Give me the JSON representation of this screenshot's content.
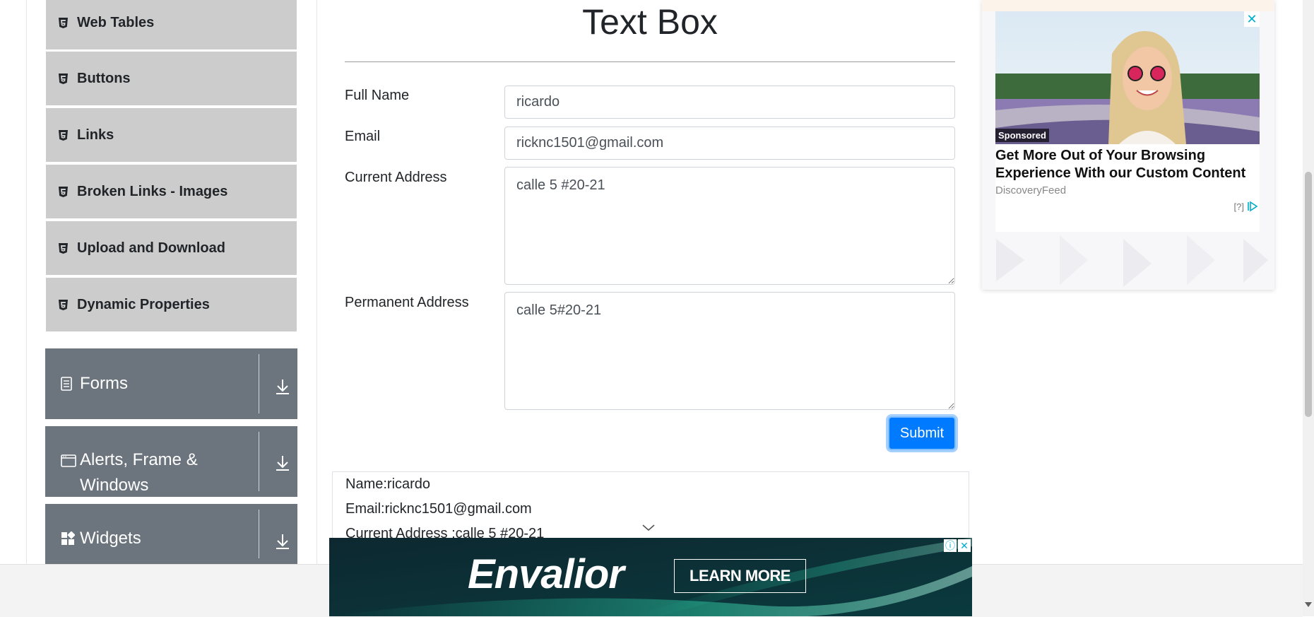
{
  "sidebar": {
    "elements_items": [
      {
        "label": "Web Tables",
        "icon": "html5-icon"
      },
      {
        "label": "Buttons",
        "icon": "html5-icon"
      },
      {
        "label": "Links",
        "icon": "html5-icon"
      },
      {
        "label": "Broken Links - Images",
        "icon": "html5-icon"
      },
      {
        "label": "Upload and Download",
        "icon": "html5-icon"
      },
      {
        "label": "Dynamic Properties",
        "icon": "html5-icon"
      }
    ],
    "groups": [
      {
        "label": "Forms",
        "icon": "document-icon"
      },
      {
        "label": "Alerts, Frame & Windows",
        "icon": "browser-window-icon"
      },
      {
        "label": "Widgets",
        "icon": "grid-icon"
      }
    ]
  },
  "main": {
    "title": "Text Box",
    "form": {
      "full_name_label": "Full Name",
      "full_name_value": "ricardo",
      "email_label": "Email",
      "email_value": "ricknc1501@gmail.com",
      "current_address_label": "Current Address",
      "current_address_value": "calle 5 #20-21",
      "permanent_address_label": "Permanent Address",
      "permanent_address_value": "calle 5#20-21",
      "submit_label": "Submit"
    },
    "output": {
      "name": "Name:ricardo",
      "email": "Email:ricknc1501@gmail.com",
      "current_address": "Current Address :calle 5 #20-21"
    }
  },
  "side_ad": {
    "sponsored": "Sponsored",
    "headline": "Get More Out of Your Browsing Experience With our Custom Content",
    "source": "DiscoveryFeed",
    "marker": "[?]",
    "close": "✕"
  },
  "banner_ad": {
    "brand": "Envalior",
    "cta": "LEARN MORE",
    "info": "ⓘ",
    "close": "✕"
  },
  "colors": {
    "primary": "#007bff",
    "sidebar_group": "#6c757d",
    "sidebar_item": "#cccccc"
  }
}
